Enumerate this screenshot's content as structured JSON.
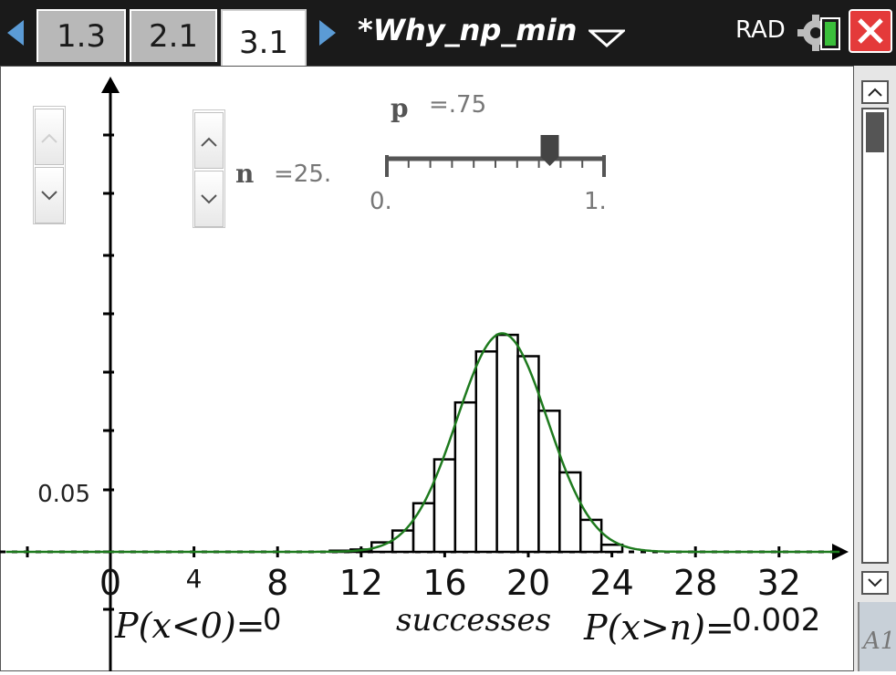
{
  "toolbar": {
    "tabs": [
      {
        "label": "1.3",
        "active": false
      },
      {
        "label": "2.1",
        "active": false
      },
      {
        "label": "3.1",
        "active": true
      }
    ],
    "document_title": "*Why_np_min",
    "angle_mode": "RAD",
    "accent_color": "#5b9bd5",
    "close_color": "#e43a3a"
  },
  "sliders": {
    "p": {
      "name": "p",
      "value_text": "=.75",
      "value": 0.75,
      "min": 0,
      "max": 1,
      "min_label": "0.",
      "max_label": "1."
    },
    "n": {
      "name": "n",
      "value_text": "=25.",
      "value": 25
    }
  },
  "side_panel": {
    "label": "A1"
  },
  "chart_data": {
    "type": "bar",
    "xlabel": "successes",
    "x_ticks": [
      "0",
      "4",
      "8",
      "12",
      "16",
      "20",
      "24",
      "28",
      "32"
    ],
    "y_tick_labels": [
      {
        "value": 0.05,
        "label": "0.05"
      }
    ],
    "xlim": [
      -5,
      35
    ],
    "ylim": [
      0,
      0.2
    ],
    "categories": [
      10,
      11,
      12,
      13,
      14,
      15,
      16,
      17,
      18,
      19,
      20,
      21,
      22,
      23,
      24
    ],
    "values": [
      0.0,
      0.001,
      0.002,
      0.008,
      0.018,
      0.041,
      0.078,
      0.126,
      0.169,
      0.183,
      0.165,
      0.119,
      0.067,
      0.027,
      0.006
    ],
    "curve": {
      "type": "line",
      "color": "#1e7a1e",
      "mean": 18.75,
      "sd": 2.165
    },
    "annotations": {
      "left_prob": "P(x<0)=",
      "left_value": "0",
      "right_prob": "P(x>n)=",
      "right_value": "0.002"
    },
    "colors": {
      "bars": "#000000",
      "curve": "#1e7a1e"
    }
  }
}
